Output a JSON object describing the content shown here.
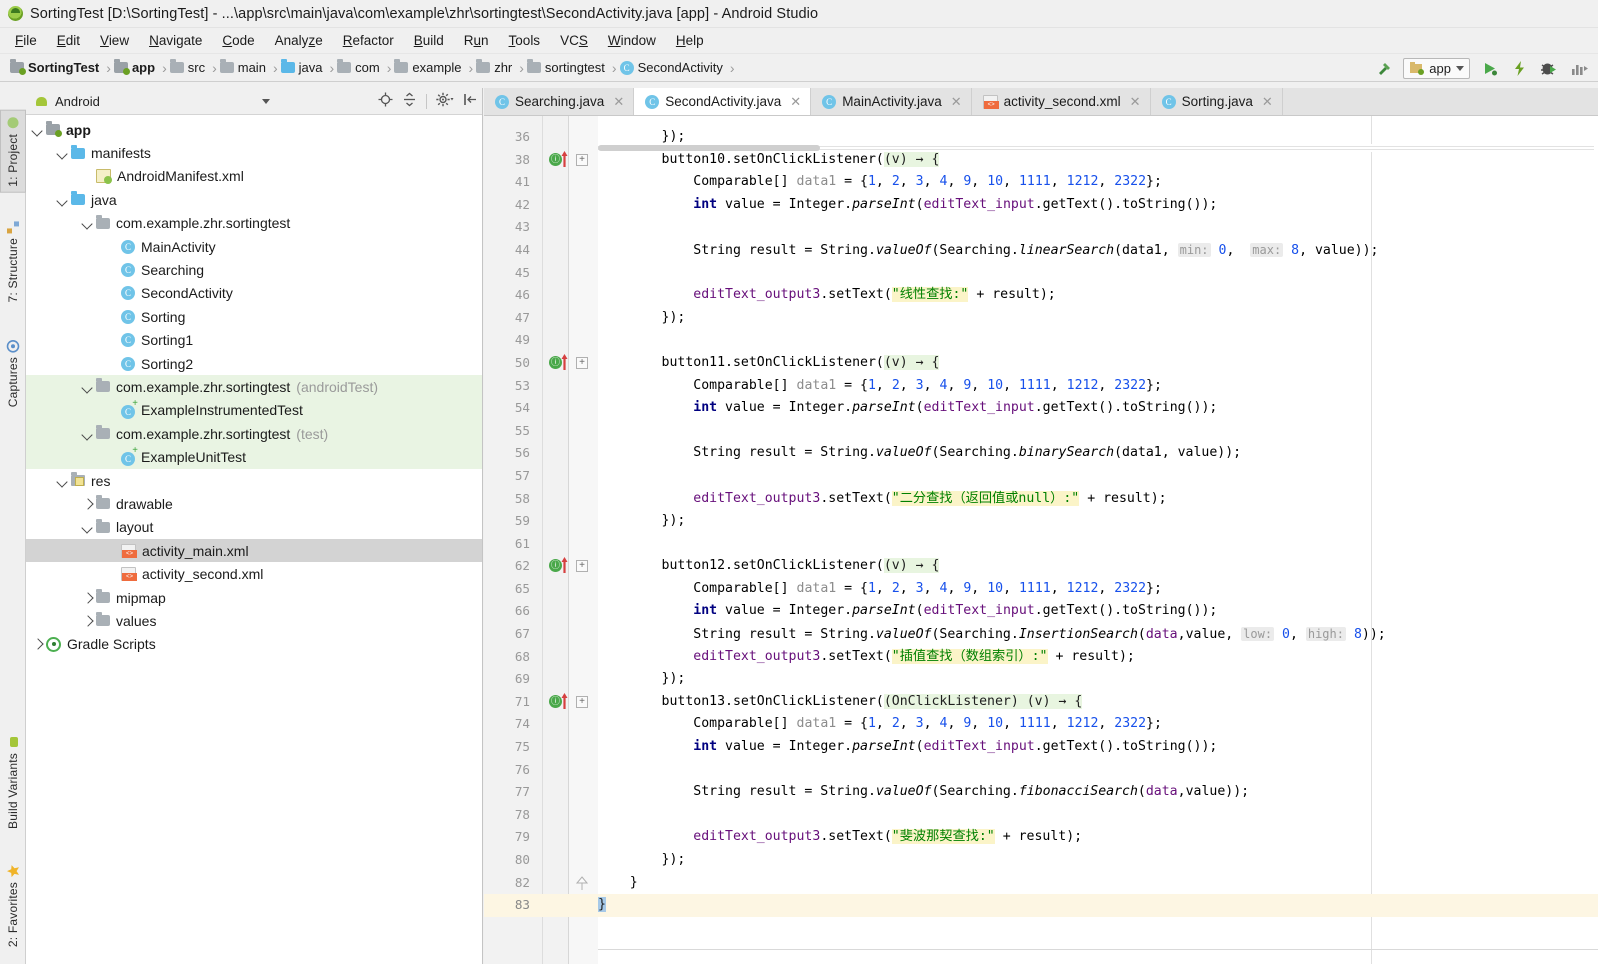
{
  "window": {
    "title": "SortingTest [D:\\SortingTest] - ...\\app\\src\\main\\java\\com\\example\\zhr\\sortingtest\\SecondActivity.java [app] - Android Studio",
    "logo_icon": "android-studio-logo"
  },
  "menubar": {
    "items": [
      {
        "label": "File",
        "mnemonic": "F"
      },
      {
        "label": "Edit",
        "mnemonic": "E"
      },
      {
        "label": "View",
        "mnemonic": "V"
      },
      {
        "label": "Navigate",
        "mnemonic": "N"
      },
      {
        "label": "Code",
        "mnemonic": "C"
      },
      {
        "label": "Analyze",
        "mnemonic": "z"
      },
      {
        "label": "Refactor",
        "mnemonic": "R"
      },
      {
        "label": "Build",
        "mnemonic": "B"
      },
      {
        "label": "Run",
        "mnemonic": "u"
      },
      {
        "label": "Tools",
        "mnemonic": "T"
      },
      {
        "label": "VCS",
        "mnemonic": "S"
      },
      {
        "label": "Window",
        "mnemonic": "W"
      },
      {
        "label": "Help",
        "mnemonic": "H"
      }
    ]
  },
  "breadcrumb": {
    "items": [
      {
        "label": "SortingTest",
        "icon": "module-folder-icon",
        "bold": true
      },
      {
        "label": "app",
        "icon": "module-folder-icon",
        "bold": true
      },
      {
        "label": "src",
        "icon": "folder-icon",
        "bold": false
      },
      {
        "label": "main",
        "icon": "folder-icon",
        "bold": false
      },
      {
        "label": "java",
        "icon": "folder-blue-icon",
        "bold": false
      },
      {
        "label": "com",
        "icon": "package-folder-icon",
        "bold": false
      },
      {
        "label": "example",
        "icon": "package-folder-icon",
        "bold": false
      },
      {
        "label": "zhr",
        "icon": "package-folder-icon",
        "bold": false
      },
      {
        "label": "sortingtest",
        "icon": "package-folder-icon",
        "bold": false
      },
      {
        "label": "SecondActivity",
        "icon": "java-class-icon",
        "bold": false
      }
    ]
  },
  "toolbar_right": {
    "build_icon": "hammer-icon",
    "run_config_label": "app",
    "run_config_icon": "android-module-icon",
    "run_icon": "run-play-icon",
    "apply_changes_icon": "lightning-icon",
    "debug_icon": "debug-bug-icon",
    "profiler_icon": "profiler-icon"
  },
  "left_strip": {
    "items": [
      {
        "label": "1: Project",
        "icon": "project-icon",
        "selected": true
      },
      {
        "label": "7: Structure",
        "icon": "structure-icon",
        "selected": false
      },
      {
        "label": "Captures",
        "icon": "captures-icon",
        "selected": false
      }
    ],
    "bottom_items": [
      {
        "label": "Build Variants",
        "icon": "android-icon",
        "selected": false
      },
      {
        "label": "2: Favorites",
        "icon": "star-icon",
        "selected": false
      }
    ]
  },
  "project_panel": {
    "header": {
      "title": "Android",
      "icon": "android-icon",
      "dropdown_icon": "chevron-down-icon",
      "locate_icon": "locate-target-icon",
      "collapse_icon": "collapse-all-icon",
      "settings_icon": "gear-icon",
      "hide_icon": "hide-panel-icon"
    },
    "tree": [
      {
        "label": "app",
        "indent": 0,
        "icon": "module-folder-icon",
        "arrow": "open",
        "bold": true,
        "suffix": "",
        "state": "normal"
      },
      {
        "label": "manifests",
        "indent": 1,
        "icon": "folder-blue-icon",
        "arrow": "open",
        "bold": false,
        "suffix": "",
        "state": "normal"
      },
      {
        "label": "AndroidManifest.xml",
        "indent": 2,
        "icon": "manifest-icon",
        "arrow": "none",
        "bold": false,
        "suffix": "",
        "state": "normal"
      },
      {
        "label": "java",
        "indent": 1,
        "icon": "folder-blue-icon",
        "arrow": "open",
        "bold": false,
        "suffix": "",
        "state": "normal"
      },
      {
        "label": "com.example.zhr.sortingtest",
        "indent": 2,
        "icon": "package-folder-icon",
        "arrow": "open",
        "bold": false,
        "suffix": "",
        "state": "normal"
      },
      {
        "label": "MainActivity",
        "indent": 3,
        "icon": "java-class-icon",
        "arrow": "none",
        "bold": false,
        "suffix": "",
        "state": "normal"
      },
      {
        "label": "Searching",
        "indent": 3,
        "icon": "java-class-icon",
        "arrow": "none",
        "bold": false,
        "suffix": "",
        "state": "normal"
      },
      {
        "label": "SecondActivity",
        "indent": 3,
        "icon": "java-class-icon",
        "arrow": "none",
        "bold": false,
        "suffix": "",
        "state": "normal"
      },
      {
        "label": "Sorting",
        "indent": 3,
        "icon": "java-class-icon",
        "arrow": "none",
        "bold": false,
        "suffix": "",
        "state": "normal"
      },
      {
        "label": "Sorting1",
        "indent": 3,
        "icon": "java-class-icon",
        "arrow": "none",
        "bold": false,
        "suffix": "",
        "state": "normal"
      },
      {
        "label": "Sorting2",
        "indent": 3,
        "icon": "java-class-icon",
        "arrow": "none",
        "bold": false,
        "suffix": "",
        "state": "normal"
      },
      {
        "label": "com.example.zhr.sortingtest",
        "indent": 2,
        "icon": "package-folder-icon",
        "arrow": "open",
        "bold": false,
        "suffix": "(androidTest)",
        "state": "test"
      },
      {
        "label": "ExampleInstrumentedTest",
        "indent": 3,
        "icon": "java-test-class-icon",
        "arrow": "none",
        "bold": false,
        "suffix": "",
        "state": "test"
      },
      {
        "label": "com.example.zhr.sortingtest",
        "indent": 2,
        "icon": "package-folder-icon",
        "arrow": "open",
        "bold": false,
        "suffix": "(test)",
        "state": "test"
      },
      {
        "label": "ExampleUnitTest",
        "indent": 3,
        "icon": "java-test-class-icon",
        "arrow": "none",
        "bold": false,
        "suffix": "",
        "state": "test"
      },
      {
        "label": "res",
        "indent": 1,
        "icon": "res-folder-icon",
        "arrow": "open",
        "bold": false,
        "suffix": "",
        "state": "normal"
      },
      {
        "label": "drawable",
        "indent": 2,
        "icon": "package-folder-icon",
        "arrow": "closed",
        "bold": false,
        "suffix": "",
        "state": "normal"
      },
      {
        "label": "layout",
        "indent": 2,
        "icon": "package-folder-icon",
        "arrow": "open",
        "bold": false,
        "suffix": "",
        "state": "normal"
      },
      {
        "label": "activity_main.xml",
        "indent": 3,
        "icon": "xml-layout-icon",
        "arrow": "none",
        "bold": false,
        "suffix": "",
        "state": "selected"
      },
      {
        "label": "activity_second.xml",
        "indent": 3,
        "icon": "xml-layout-icon",
        "arrow": "none",
        "bold": false,
        "suffix": "",
        "state": "normal"
      },
      {
        "label": "mipmap",
        "indent": 2,
        "icon": "package-folder-icon",
        "arrow": "closed",
        "bold": false,
        "suffix": "",
        "state": "normal"
      },
      {
        "label": "values",
        "indent": 2,
        "icon": "package-folder-icon",
        "arrow": "closed",
        "bold": false,
        "suffix": "",
        "state": "normal"
      },
      {
        "label": "Gradle Scripts",
        "indent": 0,
        "icon": "gradle-icon",
        "arrow": "closed",
        "bold": false,
        "suffix": "",
        "state": "normal"
      }
    ]
  },
  "editor": {
    "tabs": [
      {
        "label": "Searching.java",
        "icon": "java-class-icon",
        "active": false,
        "close_icon": "close-icon"
      },
      {
        "label": "SecondActivity.java",
        "icon": "java-class-icon",
        "active": true,
        "close_icon": "close-icon"
      },
      {
        "label": "MainActivity.java",
        "icon": "java-class-icon",
        "active": false,
        "close_icon": "close-icon"
      },
      {
        "label": "activity_second.xml",
        "icon": "xml-layout-icon",
        "active": false,
        "close_icon": "close-icon"
      },
      {
        "label": "Sorting.java",
        "icon": "java-class-icon",
        "active": false,
        "close_icon": "close-icon"
      }
    ],
    "lines": [
      {
        "num": "36",
        "marker": "none",
        "fold": "none",
        "html": "<span class=\"p\">        });</span>"
      },
      {
        "num": "38",
        "marker": "lambda",
        "fold": "plus",
        "html": "<span class=\"p\">        button10.setOnClickListener(</span><span class=\"lambda-hl\">(v) &#8594; {</span>"
      },
      {
        "num": "41",
        "marker": "none",
        "fold": "none",
        "html": "<span class=\"p\">            Comparable[] </span><span class=\"gray\">data1</span><span class=\"p\"> = {</span><span class=\"num\">1</span><span class=\"p\">, </span><span class=\"num\">2</span><span class=\"p\">, </span><span class=\"num\">3</span><span class=\"p\">, </span><span class=\"num\">4</span><span class=\"p\">, </span><span class=\"num\">9</span><span class=\"p\">, </span><span class=\"num\">10</span><span class=\"p\">, </span><span class=\"num\">1111</span><span class=\"p\">, </span><span class=\"num\">1212</span><span class=\"p\">, </span><span class=\"num\">2322</span><span class=\"p\">};</span>"
      },
      {
        "num": "42",
        "marker": "none",
        "fold": "none",
        "html": "<span class=\"p\">            </span><span class=\"k\">int</span><span class=\"p\"> value = Integer.</span><span class=\"mtd\">parseInt</span><span class=\"p\">(</span><span class=\"fld\">editText_input</span><span class=\"p\">.getText().toString());</span>"
      },
      {
        "num": "43",
        "marker": "none",
        "fold": "none",
        "html": ""
      },
      {
        "num": "44",
        "marker": "none",
        "fold": "none",
        "html": "<span class=\"p\">            String result = String.</span><span class=\"mtd\">valueOf</span><span class=\"p\">(Searching.</span><span class=\"mtd\">linearSearch</span><span class=\"p\">(data1, </span><span class=\"hint\">min:</span><span class=\"p\"> </span><span class=\"num\">0</span><span class=\"p\">,  </span><span class=\"hint\">max:</span><span class=\"p\"> </span><span class=\"num\">8</span><span class=\"p\">, value));</span>"
      },
      {
        "num": "45",
        "marker": "none",
        "fold": "none",
        "html": ""
      },
      {
        "num": "46",
        "marker": "none",
        "fold": "none",
        "html": "<span class=\"p\">            </span><span class=\"fld\">editText_output3</span><span class=\"p\">.setText(</span><span class=\"str-hl\">\"线性查找:\"</span><span class=\"p\"> + result);</span>"
      },
      {
        "num": "47",
        "marker": "none",
        "fold": "none",
        "html": "<span class=\"p\">        });</span>"
      },
      {
        "num": "49",
        "marker": "none",
        "fold": "none",
        "html": ""
      },
      {
        "num": "50",
        "marker": "lambda",
        "fold": "plus",
        "html": "<span class=\"p\">        button11.setOnClickListener(</span><span class=\"lambda-hl\">(v) &#8594; {</span>"
      },
      {
        "num": "53",
        "marker": "none",
        "fold": "none",
        "html": "<span class=\"p\">            Comparable[] </span><span class=\"gray\">data1</span><span class=\"p\"> = {</span><span class=\"num\">1</span><span class=\"p\">, </span><span class=\"num\">2</span><span class=\"p\">, </span><span class=\"num\">3</span><span class=\"p\">, </span><span class=\"num\">4</span><span class=\"p\">, </span><span class=\"num\">9</span><span class=\"p\">, </span><span class=\"num\">10</span><span class=\"p\">, </span><span class=\"num\">1111</span><span class=\"p\">, </span><span class=\"num\">1212</span><span class=\"p\">, </span><span class=\"num\">2322</span><span class=\"p\">};</span>"
      },
      {
        "num": "54",
        "marker": "none",
        "fold": "none",
        "html": "<span class=\"p\">            </span><span class=\"k\">int</span><span class=\"p\"> value = Integer.</span><span class=\"mtd\">parseInt</span><span class=\"p\">(</span><span class=\"fld\">editText_input</span><span class=\"p\">.getText().toString());</span>"
      },
      {
        "num": "55",
        "marker": "none",
        "fold": "none",
        "html": ""
      },
      {
        "num": "56",
        "marker": "none",
        "fold": "none",
        "html": "<span class=\"p\">            String result = String.</span><span class=\"mtd\">valueOf</span><span class=\"p\">(Searching.</span><span class=\"mtd\">binarySearch</span><span class=\"p\">(data1, value));</span>"
      },
      {
        "num": "57",
        "marker": "none",
        "fold": "none",
        "html": ""
      },
      {
        "num": "58",
        "marker": "none",
        "fold": "none",
        "html": "<span class=\"p\">            </span><span class=\"fld\">editText_output3</span><span class=\"p\">.setText(</span><span class=\"str-hl\">\"二分查找（返回值或null）:\"</span><span class=\"p\"> + result);</span>"
      },
      {
        "num": "59",
        "marker": "none",
        "fold": "none",
        "html": "<span class=\"p\">        });</span>"
      },
      {
        "num": "61",
        "marker": "none",
        "fold": "none",
        "html": ""
      },
      {
        "num": "62",
        "marker": "lambda",
        "fold": "plus",
        "html": "<span class=\"p\">        button12.setOnClickListener(</span><span class=\"lambda-hl\">(v) &#8594; {</span>"
      },
      {
        "num": "65",
        "marker": "none",
        "fold": "none",
        "html": "<span class=\"p\">            Comparable[] </span><span class=\"gray\">data1</span><span class=\"p\"> = {</span><span class=\"num\">1</span><span class=\"p\">, </span><span class=\"num\">2</span><span class=\"p\">, </span><span class=\"num\">3</span><span class=\"p\">, </span><span class=\"num\">4</span><span class=\"p\">, </span><span class=\"num\">9</span><span class=\"p\">, </span><span class=\"num\">10</span><span class=\"p\">, </span><span class=\"num\">1111</span><span class=\"p\">, </span><span class=\"num\">1212</span><span class=\"p\">, </span><span class=\"num\">2322</span><span class=\"p\">};</span>"
      },
      {
        "num": "66",
        "marker": "none",
        "fold": "none",
        "html": "<span class=\"p\">            </span><span class=\"k\">int</span><span class=\"p\"> value = Integer.</span><span class=\"mtd\">parseInt</span><span class=\"p\">(</span><span class=\"fld\">editText_input</span><span class=\"p\">.getText().toString());</span>"
      },
      {
        "num": "67",
        "marker": "none",
        "fold": "none",
        "html": "<span class=\"p\">            String result = String.</span><span class=\"mtd\">valueOf</span><span class=\"p\">(Searching.</span><span class=\"mtd\">InsertionSearch</span><span class=\"p\">(</span><span class=\"fld\">data</span><span class=\"p\">,value, </span><span class=\"hint\">low:</span><span class=\"p\"> </span><span class=\"num\">0</span><span class=\"p\">, </span><span class=\"hint\">high:</span><span class=\"p\"> </span><span class=\"num\">8</span><span class=\"p\">));</span>"
      },
      {
        "num": "68",
        "marker": "none",
        "fold": "none",
        "html": "<span class=\"p\">            </span><span class=\"fld\">editText_output3</span><span class=\"p\">.setText(</span><span class=\"str-hl\">\"插值查找（数组索引）:\"</span><span class=\"p\"> + result);</span>"
      },
      {
        "num": "69",
        "marker": "none",
        "fold": "none",
        "html": "<span class=\"p\">        });</span>"
      },
      {
        "num": "71",
        "marker": "lambda",
        "fold": "plus",
        "html": "<span class=\"p\">        button13.setOnClickListener(</span><span class=\"lambda-hl\">(OnClickListener) (v) &#8594; {</span>"
      },
      {
        "num": "74",
        "marker": "none",
        "fold": "none",
        "html": "<span class=\"p\">            Comparable[] </span><span class=\"gray\">data1</span><span class=\"p\"> = {</span><span class=\"num\">1</span><span class=\"p\">, </span><span class=\"num\">2</span><span class=\"p\">, </span><span class=\"num\">3</span><span class=\"p\">, </span><span class=\"num\">4</span><span class=\"p\">, </span><span class=\"num\">9</span><span class=\"p\">, </span><span class=\"num\">10</span><span class=\"p\">, </span><span class=\"num\">1111</span><span class=\"p\">, </span><span class=\"num\">1212</span><span class=\"p\">, </span><span class=\"num\">2322</span><span class=\"p\">};</span>"
      },
      {
        "num": "75",
        "marker": "none",
        "fold": "none",
        "html": "<span class=\"p\">            </span><span class=\"k\">int</span><span class=\"p\"> value = Integer.</span><span class=\"mtd\">parseInt</span><span class=\"p\">(</span><span class=\"fld\">editText_input</span><span class=\"p\">.getText().toString());</span>"
      },
      {
        "num": "76",
        "marker": "none",
        "fold": "none",
        "html": ""
      },
      {
        "num": "77",
        "marker": "none",
        "fold": "none",
        "html": "<span class=\"p\">            String result = String.</span><span class=\"mtd\">valueOf</span><span class=\"p\">(Searching.</span><span class=\"mtd\">fibonacciSearch</span><span class=\"p\">(</span><span class=\"fld\">data</span><span class=\"p\">,value));</span>"
      },
      {
        "num": "78",
        "marker": "none",
        "fold": "none",
        "html": ""
      },
      {
        "num": "79",
        "marker": "none",
        "fold": "none",
        "html": "<span class=\"p\">            </span><span class=\"fld\">editText_output3</span><span class=\"p\">.setText(</span><span class=\"str-hl\">\"斐波那契查找:\"</span><span class=\"p\"> + result);</span>"
      },
      {
        "num": "80",
        "marker": "none",
        "fold": "none",
        "html": "<span class=\"p\">        });</span>"
      },
      {
        "num": "82",
        "marker": "none",
        "fold": "end",
        "html": "<span class=\"p\">    }</span>"
      },
      {
        "num": "83",
        "marker": "none",
        "fold": "none",
        "cursor": true,
        "html": "<span class=\"sel-char\">}</span>"
      }
    ]
  },
  "colors": {
    "accent_green": "#4aa84a",
    "string_highlight": "#fbf4c8",
    "lambda_highlight": "#e8f5e0",
    "selection": "#d3d3d3",
    "test_scope": "#e9f4e3",
    "cursor_line": "#fdf6e3",
    "keyword": "#000080",
    "number": "#1750eb",
    "field": "#660e7a"
  }
}
